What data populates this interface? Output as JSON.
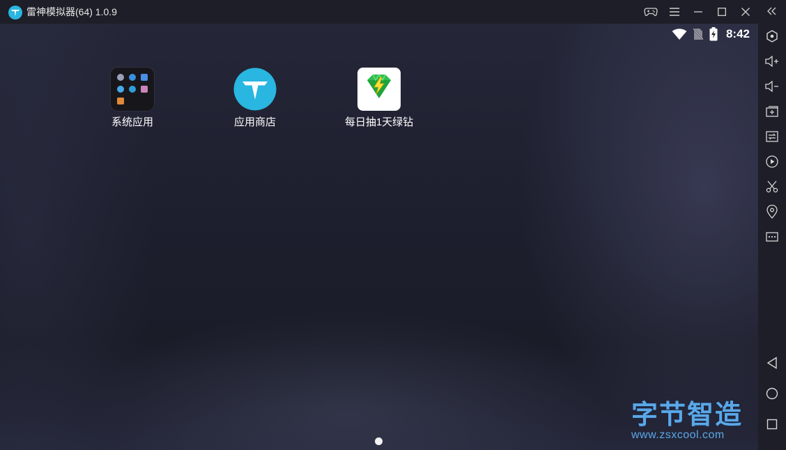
{
  "window": {
    "title": "雷神模拟器(64) 1.0.9",
    "icons": {
      "logo": "leidian-logo-icon",
      "gamepad": "gamepad-icon",
      "menu": "hamburger-menu-icon",
      "minimize": "minimize-icon",
      "maximize": "maximize-icon",
      "close": "close-icon"
    }
  },
  "status_bar": {
    "time": "8:42",
    "icons": [
      "wifi-icon",
      "no-sim-icon",
      "battery-charging-icon"
    ]
  },
  "home_screen": {
    "apps": [
      {
        "label": "系统应用",
        "icon": "system-apps-folder-icon"
      },
      {
        "label": "应用商店",
        "icon": "app-store-icon"
      },
      {
        "label": "每日抽1天绿钻",
        "icon": "green-diamond-icon"
      }
    ],
    "page_indicator": {
      "pages": 1,
      "current": 1
    }
  },
  "watermark": {
    "title": "字节智造",
    "url": "www.zsxcool.com"
  },
  "sidebar": {
    "items": [
      "collapse-icon",
      "settings-hexagon-icon",
      "volume-up-icon",
      "volume-down-icon",
      "install-apk-icon",
      "multi-instance-icon",
      "record-play-icon",
      "screenshot-scissors-icon",
      "location-pin-icon",
      "more-icon"
    ],
    "nav": [
      "back-icon",
      "home-icon",
      "recent-apps-icon"
    ]
  },
  "colors": {
    "accent": "#29b6e0",
    "watermark": "#5aa8e8",
    "titlebar": "#1d1e27"
  }
}
